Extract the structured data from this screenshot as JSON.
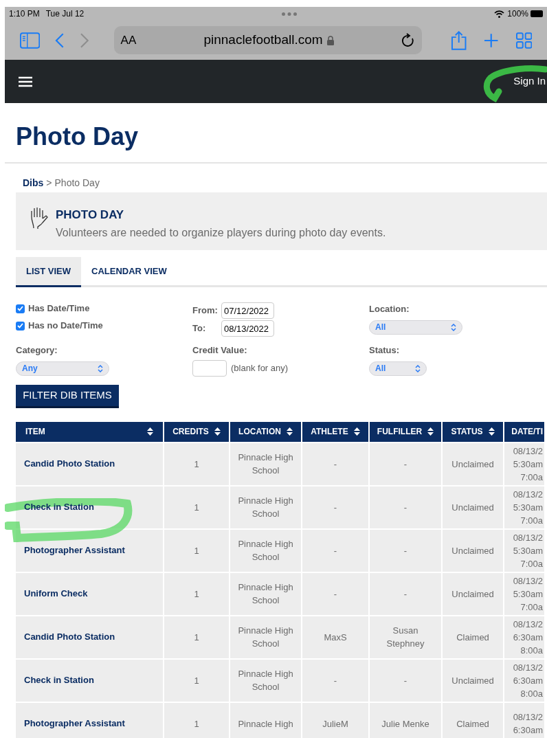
{
  "status_bar": {
    "time": "1:10 PM",
    "date": "Tue Jul 12",
    "battery": "100%"
  },
  "browser": {
    "text_size": "AA",
    "url": "pinnaclefootball.com"
  },
  "nav": {
    "sign_in": "Sign In"
  },
  "page_title": "Photo Day",
  "breadcrumb": {
    "link": "Dibs",
    "separator": ">",
    "current": "Photo Day"
  },
  "banner": {
    "title": "PHOTO DAY",
    "description": "Volunteers are needed to organize players during photo day events."
  },
  "tabs": [
    {
      "label": "LIST VIEW",
      "selected": true
    },
    {
      "label": "CALENDAR VIEW",
      "selected": false
    }
  ],
  "filters": {
    "checkboxes": [
      {
        "label": "Has Date/Time",
        "checked": true
      },
      {
        "label": "Has no Date/Time",
        "checked": true
      }
    ],
    "from": {
      "label": "From:",
      "value": "07/12/2022"
    },
    "to": {
      "label": "To:",
      "value": "08/13/2022"
    },
    "location": {
      "label": "Location:",
      "value": "All"
    },
    "category": {
      "label": "Category:",
      "value": "Any"
    },
    "credit_value": {
      "label": "Credit Value:",
      "hint": "(blank for any)"
    },
    "status": {
      "label": "Status:",
      "value": "All"
    },
    "button": "FILTER DIB ITEMS"
  },
  "table": {
    "columns": [
      "ITEM",
      "CREDITS",
      "LOCATION",
      "ATHLETE",
      "FULFILLER",
      "STATUS",
      "DATE/TI"
    ],
    "rows": [
      {
        "item": "Candid Photo Station",
        "credits": "1",
        "location": [
          "Pinnacle High",
          "School"
        ],
        "athlete": [
          "-"
        ],
        "fulfiller": [
          "-"
        ],
        "status": "Unclaimed",
        "date": [
          "08/13/2",
          "5:30am",
          "7:00a"
        ]
      },
      {
        "item": "Check in Station",
        "credits": "1",
        "location": [
          "Pinnacle High",
          "School"
        ],
        "athlete": [
          "-"
        ],
        "fulfiller": [
          "-"
        ],
        "status": "Unclaimed",
        "date": [
          "08/13/2",
          "5:30am",
          "7:00a"
        ]
      },
      {
        "item": "Photographer Assistant",
        "credits": "1",
        "location": [
          "Pinnacle High",
          "School"
        ],
        "athlete": [
          "-"
        ],
        "fulfiller": [
          "-"
        ],
        "status": "Unclaimed",
        "date": [
          "08/13/2",
          "5:30am",
          "7:00a"
        ]
      },
      {
        "item": "Uniform Check",
        "credits": "1",
        "location": [
          "Pinnacle High",
          "School"
        ],
        "athlete": [
          "-"
        ],
        "fulfiller": [
          "-"
        ],
        "status": "Unclaimed",
        "date": [
          "08/13/2",
          "5:30am",
          "7:00a"
        ]
      },
      {
        "item": "Candid Photo Station",
        "credits": "1",
        "location": [
          "Pinnacle High",
          "School"
        ],
        "athlete": [
          "MaxS"
        ],
        "fulfiller": [
          "Susan",
          "Stephney"
        ],
        "status": "Claimed",
        "date": [
          "08/13/2",
          "6:30am",
          "8:00a"
        ]
      },
      {
        "item": "Check in Station",
        "credits": "1",
        "location": [
          "Pinnacle High",
          "School"
        ],
        "athlete": [
          "-"
        ],
        "fulfiller": [
          "-"
        ],
        "status": "Unclaimed",
        "date": [
          "08/13/2",
          "6:30am",
          "8:00a"
        ]
      },
      {
        "item": "Photographer Assistant",
        "credits": "1",
        "location": [
          "Pinnacle High"
        ],
        "athlete": [
          "JulieM"
        ],
        "fulfiller": [
          "Julie Menke"
        ],
        "status": "Claimed",
        "date": [
          "08/13/2",
          "6:30am"
        ]
      }
    ]
  }
}
